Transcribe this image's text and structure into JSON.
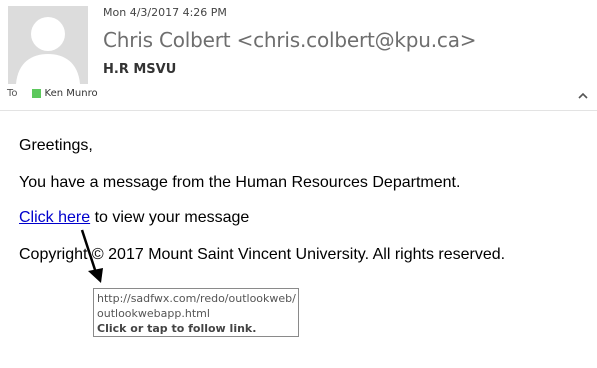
{
  "header": {
    "date": "Mon 4/3/2017 4:26 PM",
    "sender": "Chris Colbert <chris.colbert@kpu.ca>",
    "subject": "H.R MSVU",
    "to_label": "To",
    "recipient": "Ken Munro",
    "presence_color": "#5cc85c",
    "avatar_icon": "person-silhouette-icon",
    "collapse_icon": "chevron-up-icon"
  },
  "body": {
    "greeting": "Greetings,",
    "message": "You have a message from the Human Resources Department.",
    "link_text": "Click here",
    "link_suffix": " to view your message",
    "copyright": "Copyright © 2017 Mount Saint Vincent University. All rights reserved."
  },
  "tooltip": {
    "url_line1": "http://sadfwx.com/redo/outlookweb/",
    "url_line2": "outlookwebapp.html",
    "hint": "Click or tap to follow link."
  },
  "colors": {
    "link": "#0000cc",
    "sender": "#6e6e6e",
    "avatar_bg": "#dcdcdc"
  }
}
